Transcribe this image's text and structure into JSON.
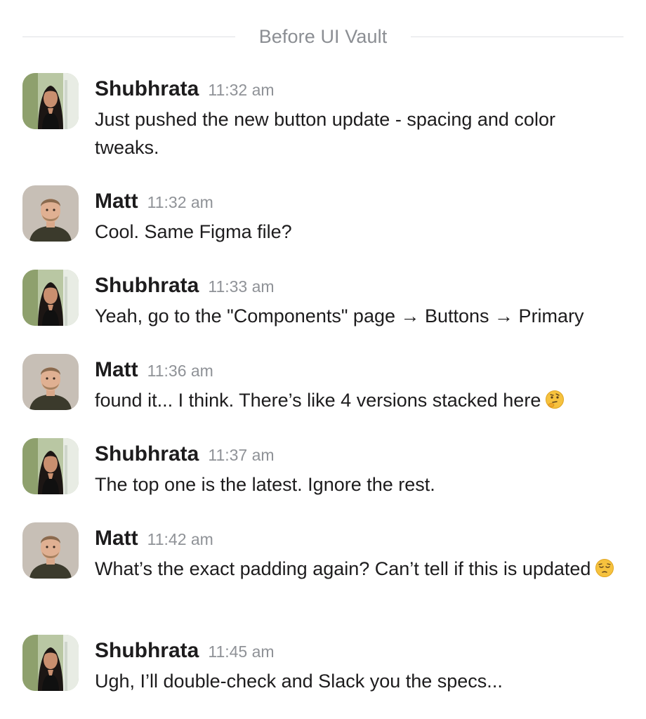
{
  "divider": {
    "label": "Before UI Vault"
  },
  "messages": [
    {
      "author": "Shubhrata",
      "time": "11:32 am",
      "text": "Just pushed the new button update - spacing and color tweaks.",
      "avatar": "shubhrata-avatar"
    },
    {
      "author": "Matt",
      "time": "11:32 am",
      "text": "Cool. Same Figma file?",
      "avatar": "matt-avatar"
    },
    {
      "author": "Shubhrata",
      "time": "11:33 am",
      "text": "Yeah, go to the \"Components\" page → Buttons → Primary",
      "avatar": "shubhrata-avatar"
    },
    {
      "author": "Matt",
      "time": "11:36 am",
      "text": "found it... I think. There’s like 4 versions stacked here",
      "emoji": "thinking-face-emoji",
      "avatar": "matt-avatar"
    },
    {
      "author": "Shubhrata",
      "time": "11:37 am",
      "text": "The top one is the latest. Ignore the rest.",
      "avatar": "shubhrata-avatar"
    },
    {
      "author": "Matt",
      "time": "11:42 am",
      "text": "What’s the exact padding again? Can’t tell if this is updated",
      "emoji": "pensive-face-emoji",
      "avatar": "matt-avatar"
    },
    {
      "author": "Shubhrata",
      "time": "11:45 am",
      "text": "Ugh, I’ll double-check and Slack you the specs...",
      "avatar": "shubhrata-avatar"
    }
  ],
  "colors": {
    "text": "#1d1c1d",
    "muted": "#8f9297",
    "divider": "#dfe1e4"
  }
}
